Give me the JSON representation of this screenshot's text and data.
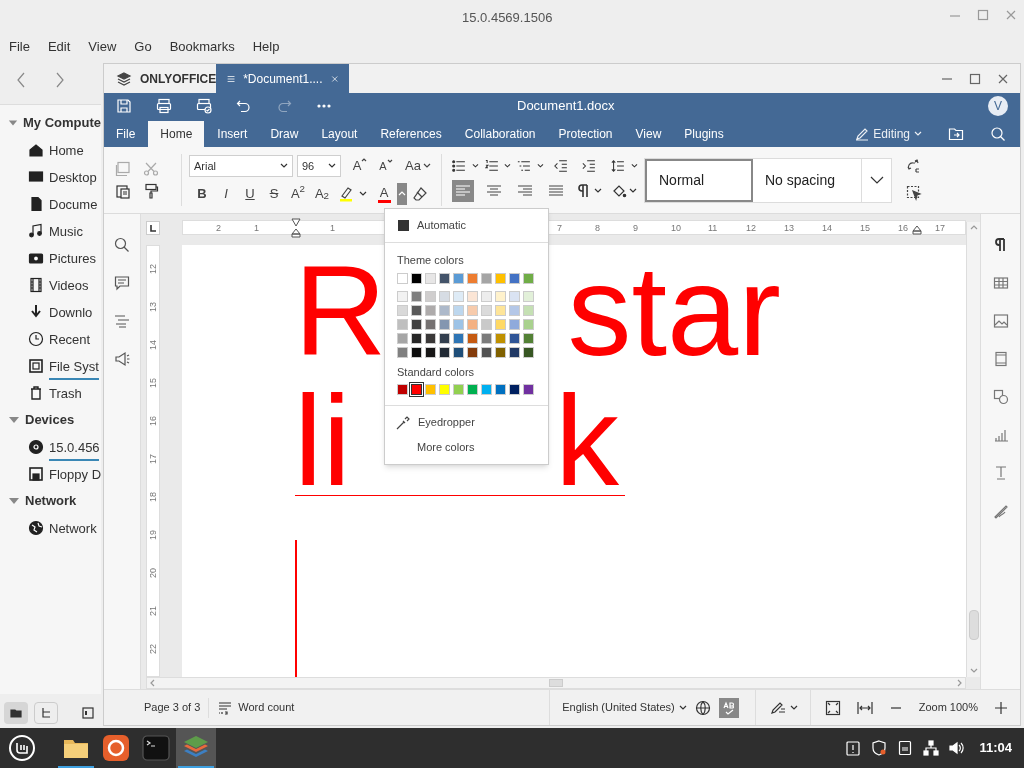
{
  "file_manager": {
    "title": "15.0.4569.1506",
    "menu": [
      "File",
      "Edit",
      "View",
      "Go",
      "Bookmarks",
      "Help"
    ],
    "sidebar": [
      {
        "label": "My Compute",
        "expanded": true,
        "children": [
          {
            "label": "Home",
            "usage_bar": false
          },
          {
            "label": "Desktop",
            "usage_bar": false
          },
          {
            "label": "Docume",
            "usage_bar": false
          },
          {
            "label": "Music",
            "usage_bar": false
          },
          {
            "label": "Pictures",
            "usage_bar": false
          },
          {
            "label": "Videos",
            "usage_bar": false
          },
          {
            "label": "Downlo",
            "usage_bar": false
          },
          {
            "label": "Recent",
            "usage_bar": false
          },
          {
            "label": "File Syst",
            "usage_bar": true
          },
          {
            "label": "Trash",
            "usage_bar": false
          }
        ]
      },
      {
        "label": "Devices",
        "expanded": true,
        "children": [
          {
            "label": "15.0.456",
            "usage_bar": true
          },
          {
            "label": "Floppy D",
            "usage_bar": false
          }
        ]
      },
      {
        "label": "Network",
        "expanded": true,
        "children": [
          {
            "label": "Network",
            "usage_bar": false
          }
        ]
      }
    ]
  },
  "editor": {
    "tabs": [
      {
        "label": "ONLYOFFICE",
        "selected": false
      },
      {
        "label": "*Document1....",
        "selected": true
      }
    ],
    "title": "Document1.docx",
    "avatar": "V",
    "redo": {
      "disabled": true
    },
    "ribbon_tabs": [
      {
        "label": "File",
        "selected": false
      },
      {
        "label": "Home",
        "selected": true
      },
      {
        "label": "Insert",
        "selected": false
      },
      {
        "label": "Draw",
        "selected": false
      },
      {
        "label": "Layout",
        "selected": false
      },
      {
        "label": "References",
        "selected": false
      },
      {
        "label": "Collaboration",
        "selected": false
      },
      {
        "label": "Protection",
        "selected": false
      },
      {
        "label": "View",
        "selected": false
      },
      {
        "label": "Plugins",
        "selected": false
      }
    ],
    "mode": "Editing",
    "font": "Arial",
    "size": "96",
    "grow_label": "A",
    "shrink_label": "A",
    "case_label": "Aa",
    "format_buttons": [
      {
        "label": "B"
      },
      {
        "label": "I"
      },
      {
        "label": "U"
      },
      {
        "label": "S"
      },
      {
        "label": "A$^{2}$"
      },
      {
        "label": "A$_{2}$"
      }
    ],
    "highlight": {
      "color": "#ffff00"
    },
    "font_color": {
      "label": "A",
      "color": "#ff0000",
      "menu_open": true
    },
    "alignment": [
      {
        "selected": true
      },
      {
        "selected": false
      },
      {
        "selected": false
      },
      {
        "selected": false
      }
    ],
    "styles": [
      {
        "label": "Normal",
        "selected": true
      },
      {
        "label": "No spacing",
        "selected": false
      }
    ],
    "ruler": {
      "horizontal": [
        "2",
        "1",
        "1",
        "7",
        "8",
        "9",
        "10",
        "11",
        "12",
        "13",
        "14",
        "15",
        "16",
        "17"
      ],
      "vertical": [
        "12",
        "13",
        "14",
        "15",
        "16",
        "17",
        "18",
        "19",
        "20",
        "21",
        "22"
      ]
    },
    "document": {
      "color": "#ff0000",
      "lines": [
        {
          "segments": [
            "R",
            "star"
          ],
          "underlined": false
        },
        {
          "segments": [
            "li",
            "k"
          ],
          "underlined": true
        }
      ]
    },
    "font_color_menu": {
      "automatic": "Automatic",
      "theme_title": "Theme colors",
      "theme_colors": [
        {
          "color": "#ffffff"
        },
        {
          "color": "#000000"
        },
        {
          "color": "#e7e6e6"
        },
        {
          "color": "#44546a"
        },
        {
          "color": "#5b9bd5"
        },
        {
          "color": "#ed7d31"
        },
        {
          "color": "#a5a5a5"
        },
        {
          "color": "#ffc000"
        },
        {
          "color": "#4472c4"
        },
        {
          "color": "#70ad47"
        }
      ],
      "shades": [
        [
          {
            "color": "#f2f2f2"
          },
          {
            "color": "#7f7f7f"
          },
          {
            "color": "#d0cece"
          },
          {
            "color": "#d6dce4"
          },
          {
            "color": "#deebf6"
          },
          {
            "color": "#fbe5d5"
          },
          {
            "color": "#ededed"
          },
          {
            "color": "#fff2cc"
          },
          {
            "color": "#dae3f3"
          },
          {
            "color": "#e2f0d9"
          }
        ],
        [
          {
            "color": "#d9d9d9"
          },
          {
            "color": "#595959"
          },
          {
            "color": "#aeabab"
          },
          {
            "color": "#adb9ca"
          },
          {
            "color": "#bdd7ee"
          },
          {
            "color": "#f7cbac"
          },
          {
            "color": "#dbdbdb"
          },
          {
            "color": "#fee599"
          },
          {
            "color": "#b4c7e7"
          },
          {
            "color": "#c5e0b4"
          }
        ],
        [
          {
            "color": "#bfbfbf"
          },
          {
            "color": "#404040"
          },
          {
            "color": "#757171"
          },
          {
            "color": "#8496b0"
          },
          {
            "color": "#9dc3e6"
          },
          {
            "color": "#f4b183"
          },
          {
            "color": "#c9c9c9"
          },
          {
            "color": "#ffd965"
          },
          {
            "color": "#8faadc"
          },
          {
            "color": "#a9d18e"
          }
        ],
        [
          {
            "color": "#a6a6a6"
          },
          {
            "color": "#262626"
          },
          {
            "color": "#3a3838"
          },
          {
            "color": "#333f4f"
          },
          {
            "color": "#2e75b5"
          },
          {
            "color": "#c55a11"
          },
          {
            "color": "#7b7b7b"
          },
          {
            "color": "#bf9000"
          },
          {
            "color": "#2f5597"
          },
          {
            "color": "#538135"
          }
        ],
        [
          {
            "color": "#808080"
          },
          {
            "color": "#0d0d0d"
          },
          {
            "color": "#171616"
          },
          {
            "color": "#222a35"
          },
          {
            "color": "#1f4e79"
          },
          {
            "color": "#843c0b"
          },
          {
            "color": "#525252"
          },
          {
            "color": "#7f6000"
          },
          {
            "color": "#203864"
          },
          {
            "color": "#375623"
          }
        ]
      ],
      "standard_title": "Standard colors",
      "standard_colors": [
        {
          "color": "#c00000",
          "selected": false
        },
        {
          "color": "#ff0000",
          "selected": true
        },
        {
          "color": "#ffc000",
          "selected": false
        },
        {
          "color": "#ffff00",
          "selected": false
        },
        {
          "color": "#92d050",
          "selected": false
        },
        {
          "color": "#00b050",
          "selected": false
        },
        {
          "color": "#00b0f0",
          "selected": false
        },
        {
          "color": "#0070c0",
          "selected": false
        },
        {
          "color": "#002060",
          "selected": false
        },
        {
          "color": "#7030a0",
          "selected": false
        }
      ],
      "eyedropper": "Eyedropper",
      "more": "More colors"
    },
    "status_bar": {
      "page": "Page 3 of 3",
      "word_count": "Word count",
      "language": "English (United States)",
      "spellcheck": true,
      "zoom": "Zoom 100%"
    }
  },
  "taskbar": {
    "apps": [
      {
        "running": true,
        "active": false
      },
      {
        "running": false,
        "active": false
      },
      {
        "running": false,
        "active": false
      },
      {
        "running": true,
        "active": true
      }
    ],
    "time": "11:04"
  }
}
